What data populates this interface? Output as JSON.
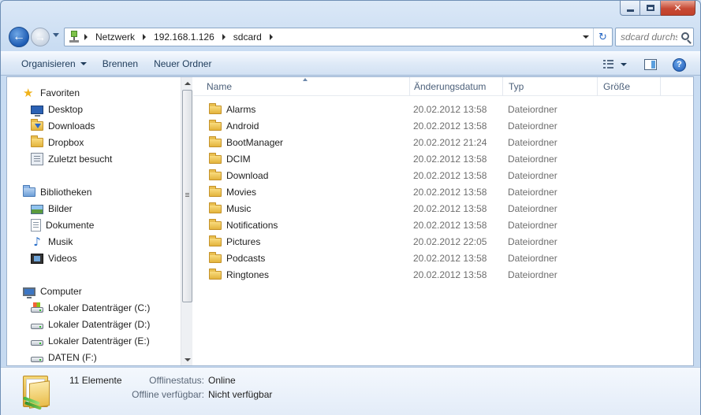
{
  "window": {
    "caption": {
      "minimize": "",
      "maximize": "",
      "close": "✕"
    }
  },
  "nav": {
    "breadcrumb": [
      "Netzwerk",
      "192.168.1.126",
      "sdcard"
    ],
    "search_placeholder": "sdcard durchsuchen"
  },
  "toolbar": {
    "organize": "Organisieren",
    "burn": "Brennen",
    "new_folder": "Neuer Ordner",
    "help": "?"
  },
  "sidebar": {
    "favorites": {
      "label": "Favoriten",
      "items": [
        {
          "label": "Desktop",
          "icon": "desktop-icon"
        },
        {
          "label": "Downloads",
          "icon": "downloads-folder-icon"
        },
        {
          "label": "Dropbox",
          "icon": "folder-icon"
        },
        {
          "label": "Zuletzt besucht",
          "icon": "recent-places-icon"
        }
      ]
    },
    "libraries": {
      "label": "Bibliotheken",
      "items": [
        {
          "label": "Bilder",
          "icon": "pictures-icon"
        },
        {
          "label": "Dokumente",
          "icon": "documents-icon"
        },
        {
          "label": "Musik",
          "icon": "music-icon"
        },
        {
          "label": "Videos",
          "icon": "videos-icon"
        }
      ]
    },
    "computer": {
      "label": "Computer",
      "items": [
        {
          "label": "Lokaler Datenträger (C:)",
          "icon": "system-drive-icon"
        },
        {
          "label": "Lokaler Datenträger (D:)",
          "icon": "drive-icon"
        },
        {
          "label": "Lokaler Datenträger (E:)",
          "icon": "drive-icon"
        },
        {
          "label": "DATEN (F:)",
          "icon": "drive-icon"
        }
      ]
    }
  },
  "columns": {
    "name": "Name",
    "date": "Änderungsdatum",
    "type": "Typ",
    "size": "Größe"
  },
  "files": [
    {
      "name": "Alarms",
      "date": "20.02.2012 13:58",
      "type": "Dateiordner"
    },
    {
      "name": "Android",
      "date": "20.02.2012 13:58",
      "type": "Dateiordner"
    },
    {
      "name": "BootManager",
      "date": "20.02.2012 21:24",
      "type": "Dateiordner"
    },
    {
      "name": "DCIM",
      "date": "20.02.2012 13:58",
      "type": "Dateiordner"
    },
    {
      "name": "Download",
      "date": "20.02.2012 13:58",
      "type": "Dateiordner"
    },
    {
      "name": "Movies",
      "date": "20.02.2012 13:58",
      "type": "Dateiordner"
    },
    {
      "name": "Music",
      "date": "20.02.2012 13:58",
      "type": "Dateiordner"
    },
    {
      "name": "Notifications",
      "date": "20.02.2012 13:58",
      "type": "Dateiordner"
    },
    {
      "name": "Pictures",
      "date": "20.02.2012 22:05",
      "type": "Dateiordner"
    },
    {
      "name": "Podcasts",
      "date": "20.02.2012 13:58",
      "type": "Dateiordner"
    },
    {
      "name": "Ringtones",
      "date": "20.02.2012 13:58",
      "type": "Dateiordner"
    }
  ],
  "details": {
    "count": "11 Elemente",
    "offline_status_label": "Offlinestatus:",
    "offline_status_value": "Online",
    "offline_available_label": "Offline verfügbar:",
    "offline_available_value": "Nicht verfügbar"
  }
}
